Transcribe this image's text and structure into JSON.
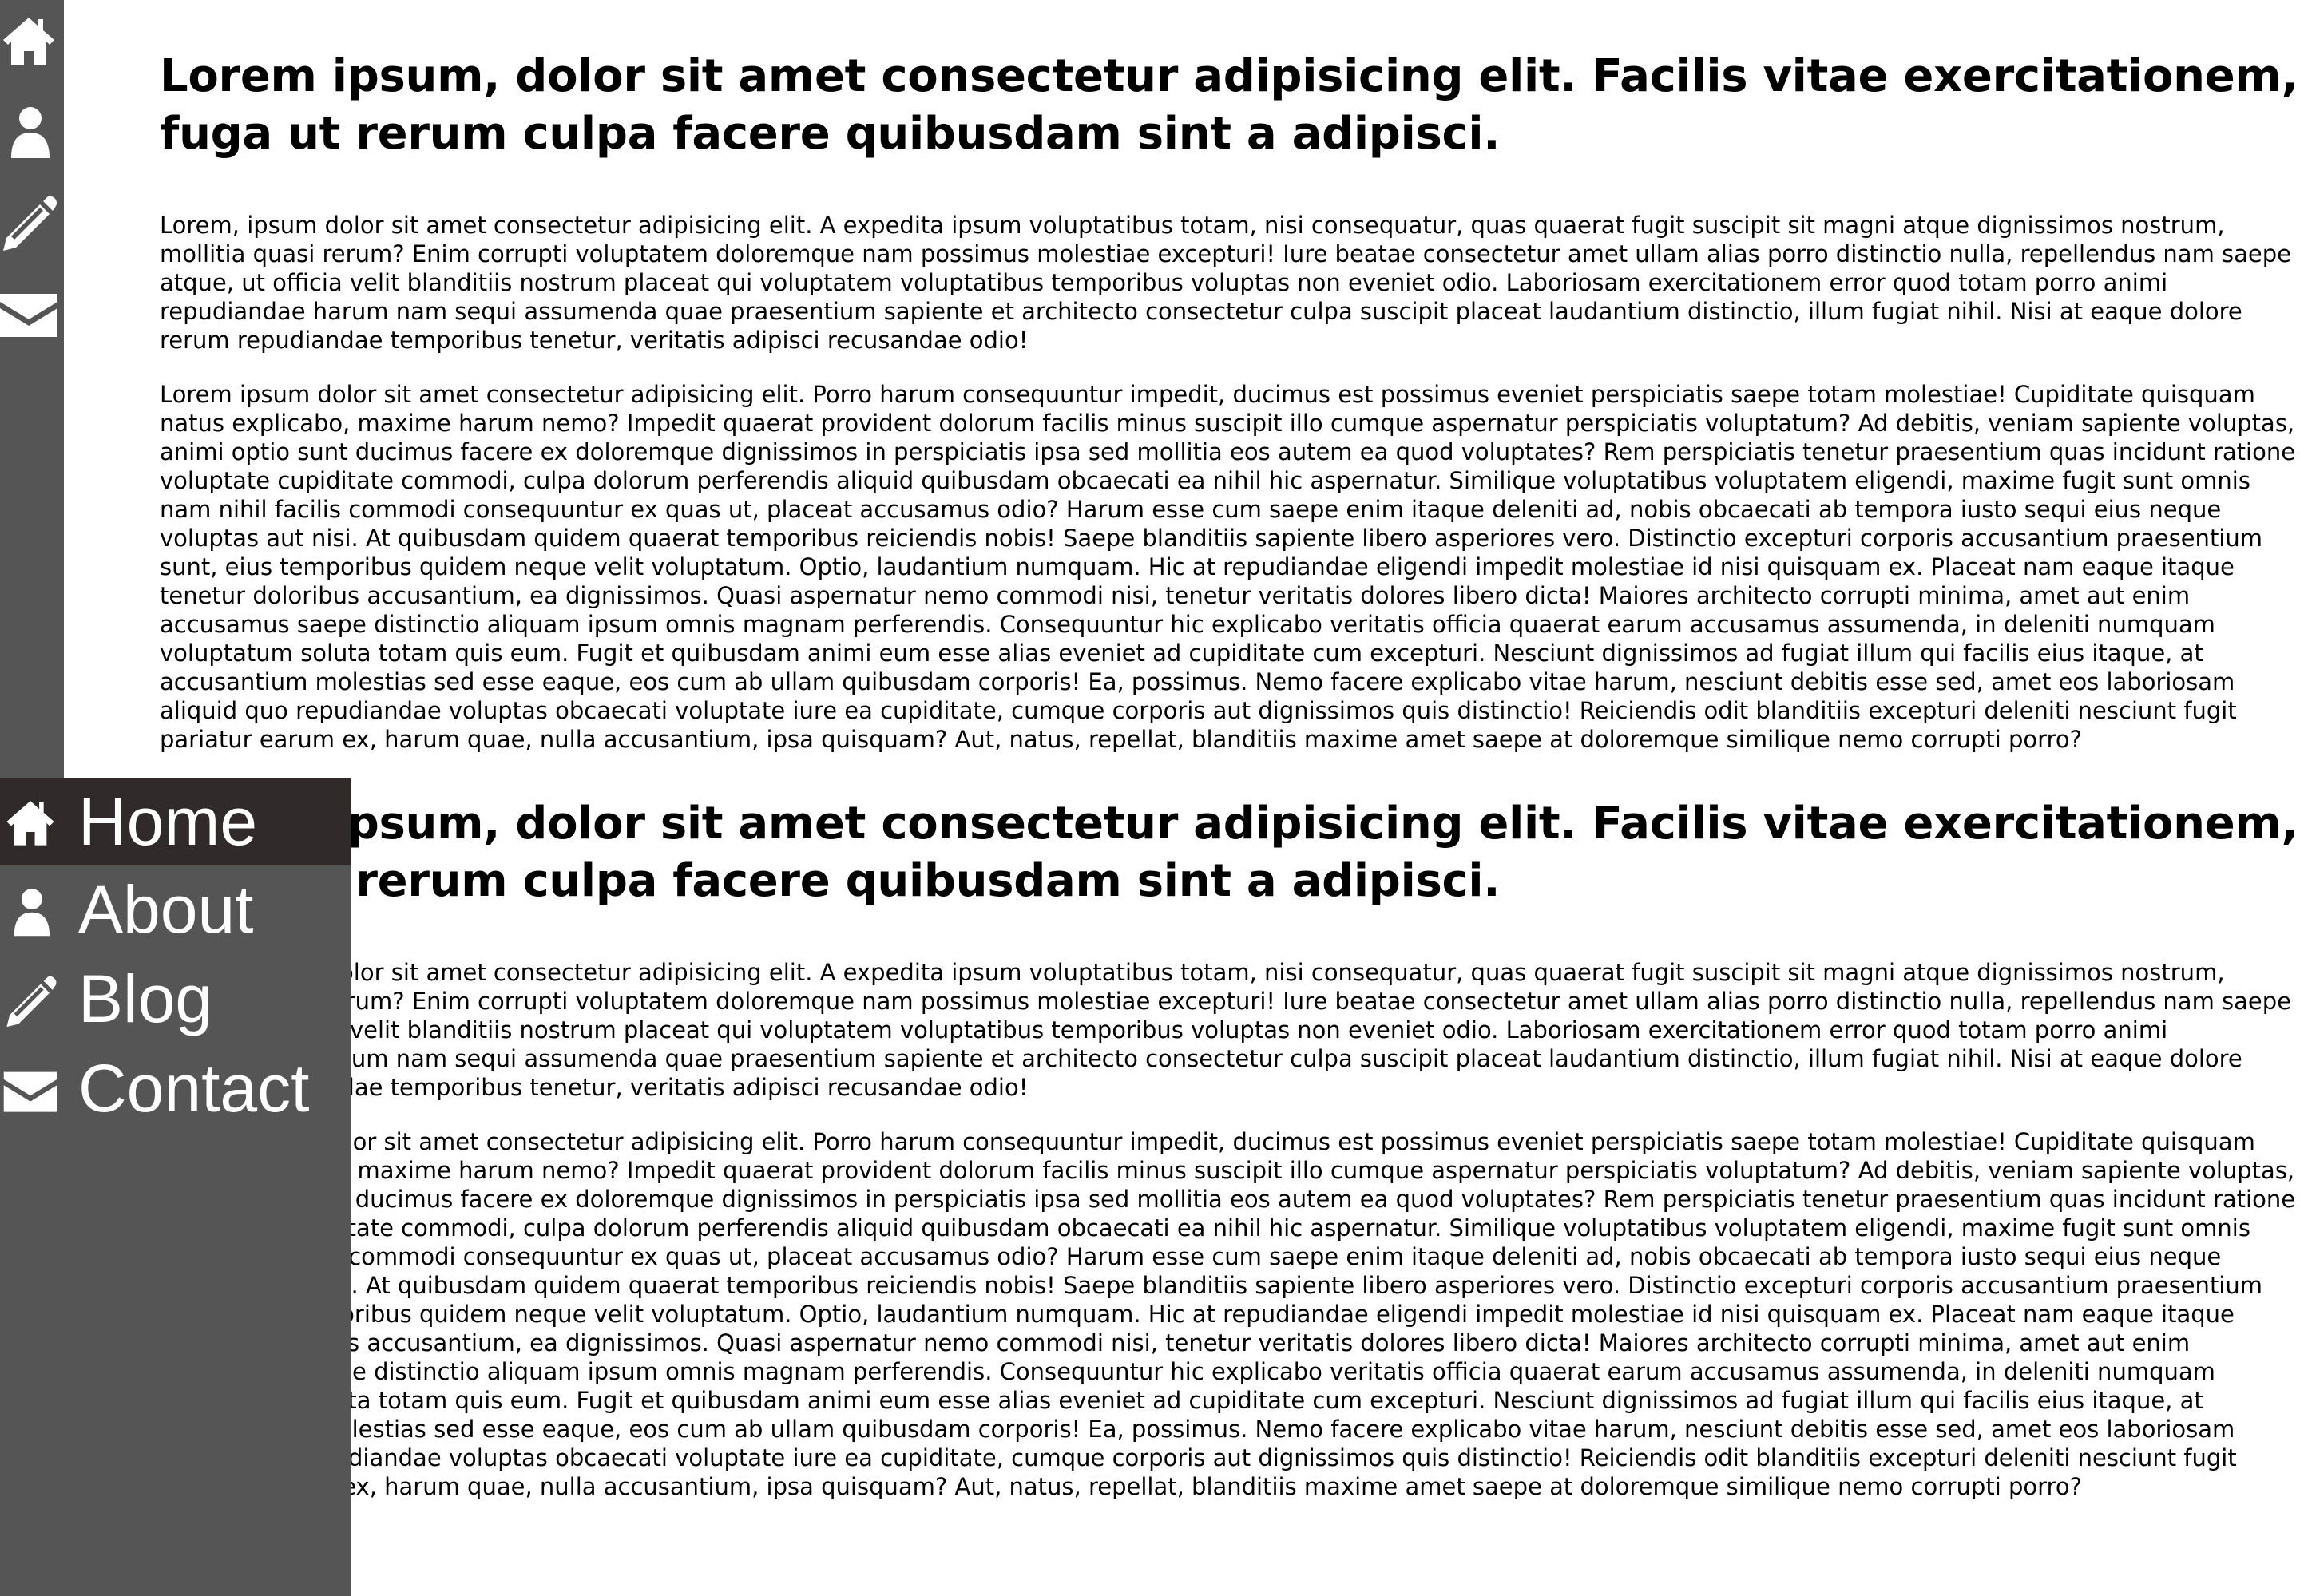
{
  "icon_bar": {
    "icons": [
      "home-icon",
      "user-icon",
      "pencil-icon",
      "envelope-icon"
    ]
  },
  "menu": {
    "items": [
      {
        "label": "Home",
        "icon": "home-icon",
        "active": true
      },
      {
        "label": "About",
        "icon": "user-icon",
        "active": false
      },
      {
        "label": "Blog",
        "icon": "pencil-icon",
        "active": false
      },
      {
        "label": "Contact",
        "icon": "envelope-icon",
        "active": false
      }
    ]
  },
  "colors": {
    "sidebar": "#555555",
    "active_item": "#302b2a",
    "text": "#000000",
    "menu_text": "#ffffff"
  },
  "sections": [
    {
      "heading": "Lorem ipsum, dolor sit amet consectetur adipisicing elit. Facilis vitae exercitationem, fuga ut rerum culpa facere quibusdam sint a adipisci.",
      "para1": "Lorem, ipsum dolor sit amet consectetur adipisicing elit. A expedita ipsum voluptatibus totam, nisi consequatur, quas quaerat fugit suscipit sit magni atque dignissimos nostrum, mollitia quasi rerum? Enim corrupti voluptatem doloremque nam possimus molestiae excepturi! Iure beatae consectetur amet ullam alias porro distinctio nulla, repellendus nam saepe atque, ut officia velit blanditiis nostrum placeat qui voluptatem voluptatibus temporibus voluptas non eveniet odio. Laboriosam exercitationem error quod totam porro animi repudiandae harum nam sequi assumenda quae praesentium sapiente et architecto consectetur culpa suscipit placeat laudantium distinctio, illum fugiat nihil. Nisi at eaque dolore rerum repudiandae temporibus tenetur, veritatis adipisci recusandae odio!",
      "para2": "Lorem ipsum dolor sit amet consectetur adipisicing elit. Porro harum consequuntur impedit, ducimus est possimus eveniet perspiciatis saepe totam molestiae! Cupiditate quisquam natus explicabo, maxime harum nemo? Impedit quaerat provident dolorum facilis minus suscipit illo cumque aspernatur perspiciatis voluptatum? Ad debitis, veniam sapiente voluptas, animi optio sunt ducimus facere ex doloremque dignissimos in perspiciatis ipsa sed mollitia eos autem ea quod voluptates? Rem perspiciatis tenetur praesentium quas incidunt ratione voluptate cupiditate commodi, culpa dolorum perferendis aliquid quibusdam obcaecati ea nihil hic aspernatur. Similique voluptatibus voluptatem eligendi, maxime fugit sunt omnis nam nihil facilis commodi consequuntur ex quas ut, placeat accusamus odio? Harum esse cum saepe enim itaque deleniti ad, nobis obcaecati ab tempora iusto sequi eius neque voluptas aut nisi. At quibusdam quidem quaerat temporibus reiciendis nobis! Saepe blanditiis sapiente libero asperiores vero. Distinctio excepturi corporis accusantium praesentium sunt, eius temporibus quidem neque velit voluptatum. Optio, laudantium numquam. Hic at repudiandae eligendi impedit molestiae id nisi quisquam ex. Placeat nam eaque itaque tenetur doloribus accusantium, ea dignissimos. Quasi aspernatur nemo commodi nisi, tenetur veritatis dolores libero dicta! Maiores architecto corrupti minima, amet aut enim accusamus saepe distinctio aliquam ipsum omnis magnam perferendis. Consequuntur hic explicabo veritatis officia quaerat earum accusamus assumenda, in deleniti numquam voluptatum soluta totam quis eum. Fugit et quibusdam animi eum esse alias eveniet ad cupiditate cum excepturi. Nesciunt dignissimos ad fugiat illum qui facilis eius itaque, at accusantium molestias sed esse eaque, eos cum ab ullam quibusdam corporis! Ea, possimus. Nemo facere explicabo vitae harum, nesciunt debitis esse sed, amet eos laboriosam aliquid quo repudiandae voluptas obcaecati voluptate iure ea cupiditate, cumque corporis aut dignissimos quis distinctio! Reiciendis odit blanditiis excepturi deleniti nesciunt fugit pariatur earum ex, harum quae, nulla accusantium, ipsa quisquam? Aut, natus, repellat, blanditiis maxime amet saepe at doloremque similique nemo corrupti porro?"
    },
    {
      "heading": "Lorem ipsum, dolor sit amet consectetur adipisicing elit. Facilis vitae exercitationem, fuga ut rerum culpa facere quibusdam sint a adipisci.",
      "para1": "Lorem, ipsum dolor sit amet consectetur adipisicing elit. A expedita ipsum voluptatibus totam, nisi consequatur, quas quaerat fugit suscipit sit magni atque dignissimos nostrum, mollitia quasi rerum? Enim corrupti voluptatem doloremque nam possimus molestiae excepturi! Iure beatae consectetur amet ullam alias porro distinctio nulla, repellendus nam saepe atque, ut officia velit blanditiis nostrum placeat qui voluptatem voluptatibus temporibus voluptas non eveniet odio. Laboriosam exercitationem error quod totam porro animi repudiandae harum nam sequi assumenda quae praesentium sapiente et architecto consectetur culpa suscipit placeat laudantium distinctio, illum fugiat nihil. Nisi at eaque dolore rerum repudiandae temporibus tenetur, veritatis adipisci recusandae odio!",
      "para2": "Lorem ipsum dolor sit amet consectetur adipisicing elit. Porro harum consequuntur impedit, ducimus est possimus eveniet perspiciatis saepe totam molestiae! Cupiditate quisquam natus explicabo, maxime harum nemo? Impedit quaerat provident dolorum facilis minus suscipit illo cumque aspernatur perspiciatis voluptatum? Ad debitis, veniam sapiente voluptas, animi optio sunt ducimus facere ex doloremque dignissimos in perspiciatis ipsa sed mollitia eos autem ea quod voluptates? Rem perspiciatis tenetur praesentium quas incidunt ratione voluptate cupiditate commodi, culpa dolorum perferendis aliquid quibusdam obcaecati ea nihil hic aspernatur. Similique voluptatibus voluptatem eligendi, maxime fugit sunt omnis nam nihil facilis commodi consequuntur ex quas ut, placeat accusamus odio? Harum esse cum saepe enim itaque deleniti ad, nobis obcaecati ab tempora iusto sequi eius neque voluptas aut nisi. At quibusdam quidem quaerat temporibus reiciendis nobis! Saepe blanditiis sapiente libero asperiores vero. Distinctio excepturi corporis accusantium praesentium sunt, eius temporibus quidem neque velit voluptatum. Optio, laudantium numquam. Hic at repudiandae eligendi impedit molestiae id nisi quisquam ex. Placeat nam eaque itaque tenetur doloribus accusantium, ea dignissimos. Quasi aspernatur nemo commodi nisi, tenetur veritatis dolores libero dicta! Maiores architecto corrupti minima, amet aut enim accusamus saepe distinctio aliquam ipsum omnis magnam perferendis. Consequuntur hic explicabo veritatis officia quaerat earum accusamus assumenda, in deleniti numquam voluptatum soluta totam quis eum. Fugit et quibusdam animi eum esse alias eveniet ad cupiditate cum excepturi. Nesciunt dignissimos ad fugiat illum qui facilis eius itaque, at accusantium molestias sed esse eaque, eos cum ab ullam quibusdam corporis! Ea, possimus. Nemo facere explicabo vitae harum, nesciunt debitis esse sed, amet eos laboriosam aliquid quo repudiandae voluptas obcaecati voluptate iure ea cupiditate, cumque corporis aut dignissimos quis distinctio! Reiciendis odit blanditiis excepturi deleniti nesciunt fugit pariatur earum ex, harum quae, nulla accusantium, ipsa quisquam? Aut, natus, repellat, blanditiis maxime amet saepe at doloremque similique nemo corrupti porro?"
    }
  ]
}
